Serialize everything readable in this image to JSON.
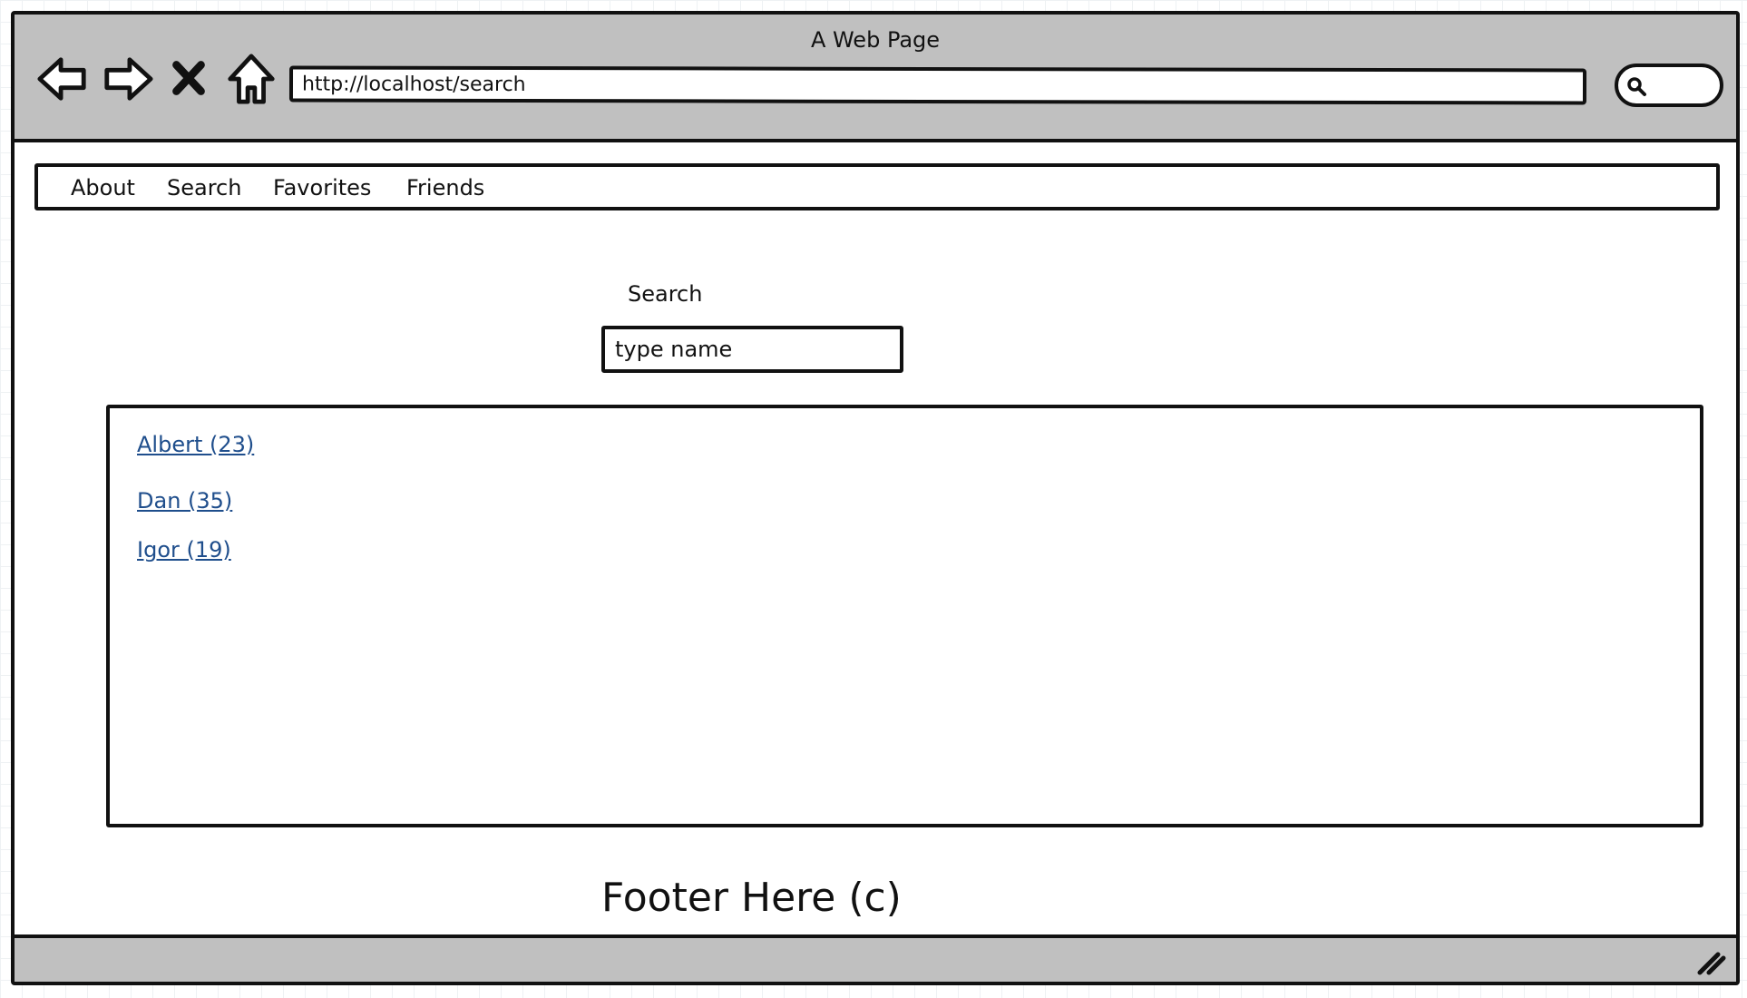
{
  "window": {
    "title": "A Web Page",
    "url": "http://localhost/search"
  },
  "toolbar": {
    "icons": [
      "back-icon",
      "forward-icon",
      "stop-icon",
      "home-icon",
      "search-icon"
    ]
  },
  "nav": {
    "items": [
      {
        "label": "About"
      },
      {
        "label": "Search"
      },
      {
        "label": "Favorites"
      },
      {
        "label": "Friends"
      }
    ]
  },
  "search": {
    "label": "Search",
    "value": "",
    "placeholder": "type name"
  },
  "results": {
    "items": [
      {
        "label": "Albert (23)"
      },
      {
        "label": "Dan (35)"
      },
      {
        "label": "Igor (19)"
      }
    ]
  },
  "footer": {
    "text": "Footer Here (c)"
  },
  "colors": {
    "chrome": "#c0c0c0",
    "border": "#111111",
    "link": "#1f4e8c"
  }
}
